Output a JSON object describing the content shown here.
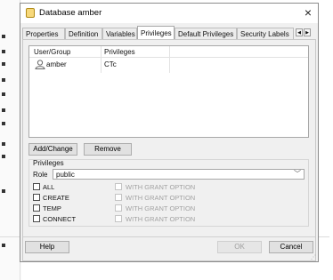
{
  "window": {
    "title": "Database amber",
    "close_glyph": "×",
    "colors": {
      "folder_icon": "#f7d87a",
      "panel_bg": "#f0f0f0"
    }
  },
  "tabs": [
    {
      "label": "Properties",
      "active": false
    },
    {
      "label": "Definition",
      "active": false
    },
    {
      "label": "Variables",
      "active": false
    },
    {
      "label": "Privileges",
      "active": true
    },
    {
      "label": "Default Privileges",
      "active": false
    },
    {
      "label": "Security Labels",
      "active": false
    }
  ],
  "tab_scroll": {
    "left": "◀",
    "right": "▶"
  },
  "grid": {
    "columns": [
      "User/Group",
      "Privileges"
    ],
    "rows": [
      {
        "user": "amber",
        "user_icon": "user-icon",
        "privileges": "CTc"
      }
    ]
  },
  "actions": {
    "add_change": "Add/Change",
    "remove": "Remove"
  },
  "privileges_section": {
    "legend": "Privileges",
    "role_label": "Role",
    "role_value": "public",
    "items": [
      {
        "label": "ALL",
        "grant_label": "WITH GRANT OPTION"
      },
      {
        "label": "CREATE",
        "grant_label": "WITH GRANT OPTION"
      },
      {
        "label": "TEMP",
        "grant_label": "WITH GRANT OPTION"
      },
      {
        "label": "CONNECT",
        "grant_label": "WITH GRANT OPTION"
      }
    ]
  },
  "footer": {
    "help": "Help",
    "ok": "OK",
    "cancel": "Cancel"
  }
}
